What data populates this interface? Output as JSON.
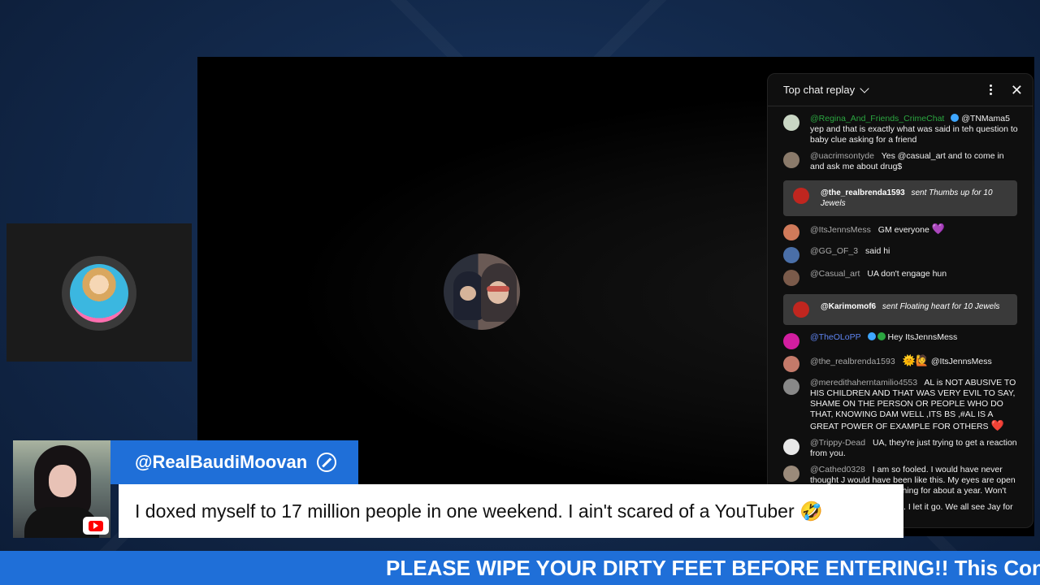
{
  "chat": {
    "title": "Top chat replay",
    "messages": [
      {
        "author": "@Regina_And_Friends_CrimeChat",
        "text": "@TNMama5 yep and that is exactly what was said in teh question to baby clue asking for a friend",
        "avatar_color": "#c9d6c4"
      },
      {
        "author": "@uacrimsontyde",
        "text": "Yes @casual_art and to come in and ask me about drug$",
        "avatar_color": "#8a7a6a"
      },
      {
        "gift_author": "@the_realbrenda1593",
        "gift_text": "sent Thumbs up for 10 Jewels"
      },
      {
        "author": "@ItsJennsMess",
        "text": "GM everyone",
        "emoji": "💜",
        "avatar_color": "#d07a5a"
      },
      {
        "author": "@GG_OF_3",
        "text": "said hi",
        "avatar_color": "#4a6fa8"
      },
      {
        "author": "@Casual_art",
        "text": "UA don't engage hun",
        "avatar_color": "#7a5a4a"
      },
      {
        "gift_author": "@Karimomof6",
        "gift_text": "sent Floating heart for 10 Jewels"
      },
      {
        "author": "@TheOLoPP",
        "text": "Hey ItsJennsMess",
        "avatar_color": "#d21ea0"
      },
      {
        "author": "@the_realbrenda1593",
        "text": "@ItsJennsMess",
        "emoji": "🌞🙋",
        "avatar_color": "#c47a6a"
      },
      {
        "author": "@meredithaherntamilio4553",
        "text": "AL is NOT ABUSIVE TO HIS CHILDREN AND THAT WAS VERY EVIL TO SAY, SHAME ON THE PERSON OR PEOPLE WHO DO THAT, KNOWING DAM WELL ,ITS BS ,#AL IS A GREAT POWER OF EXAMPLE FOR OTHERS",
        "emoji": "❤️",
        "avatar_color": "#888888"
      },
      {
        "author": "@Trippy-Dead",
        "text": "UA, they're just trying to get a reaction from you.",
        "avatar_color": "#e8e8e8"
      },
      {
        "author": "@Cathed0328",
        "text": "I am so fooled. I would have never thought J would have been like this. My eyes are open now. I've only been watching for about a year. Won't",
        "avatar_color": "#9a8a7a"
      }
    ],
    "partial_tail": "op engaging and let it go. I let it go. We all see Jay for"
  },
  "overlay": {
    "handle": "@RealBaudiMoovan",
    "quote": "I doxed myself to 17 million people in one weekend. I ain't scared of a YouTuber 🤣",
    "ticker": "PLEASE WIPE YOUR DIRTY FEET BEFORE ENTERING!! This Conter"
  },
  "colors": {
    "accent_blue": "#1f6fd8",
    "chat_bg": "#0f0f0f",
    "gift_bg": "#3a3a3a"
  }
}
